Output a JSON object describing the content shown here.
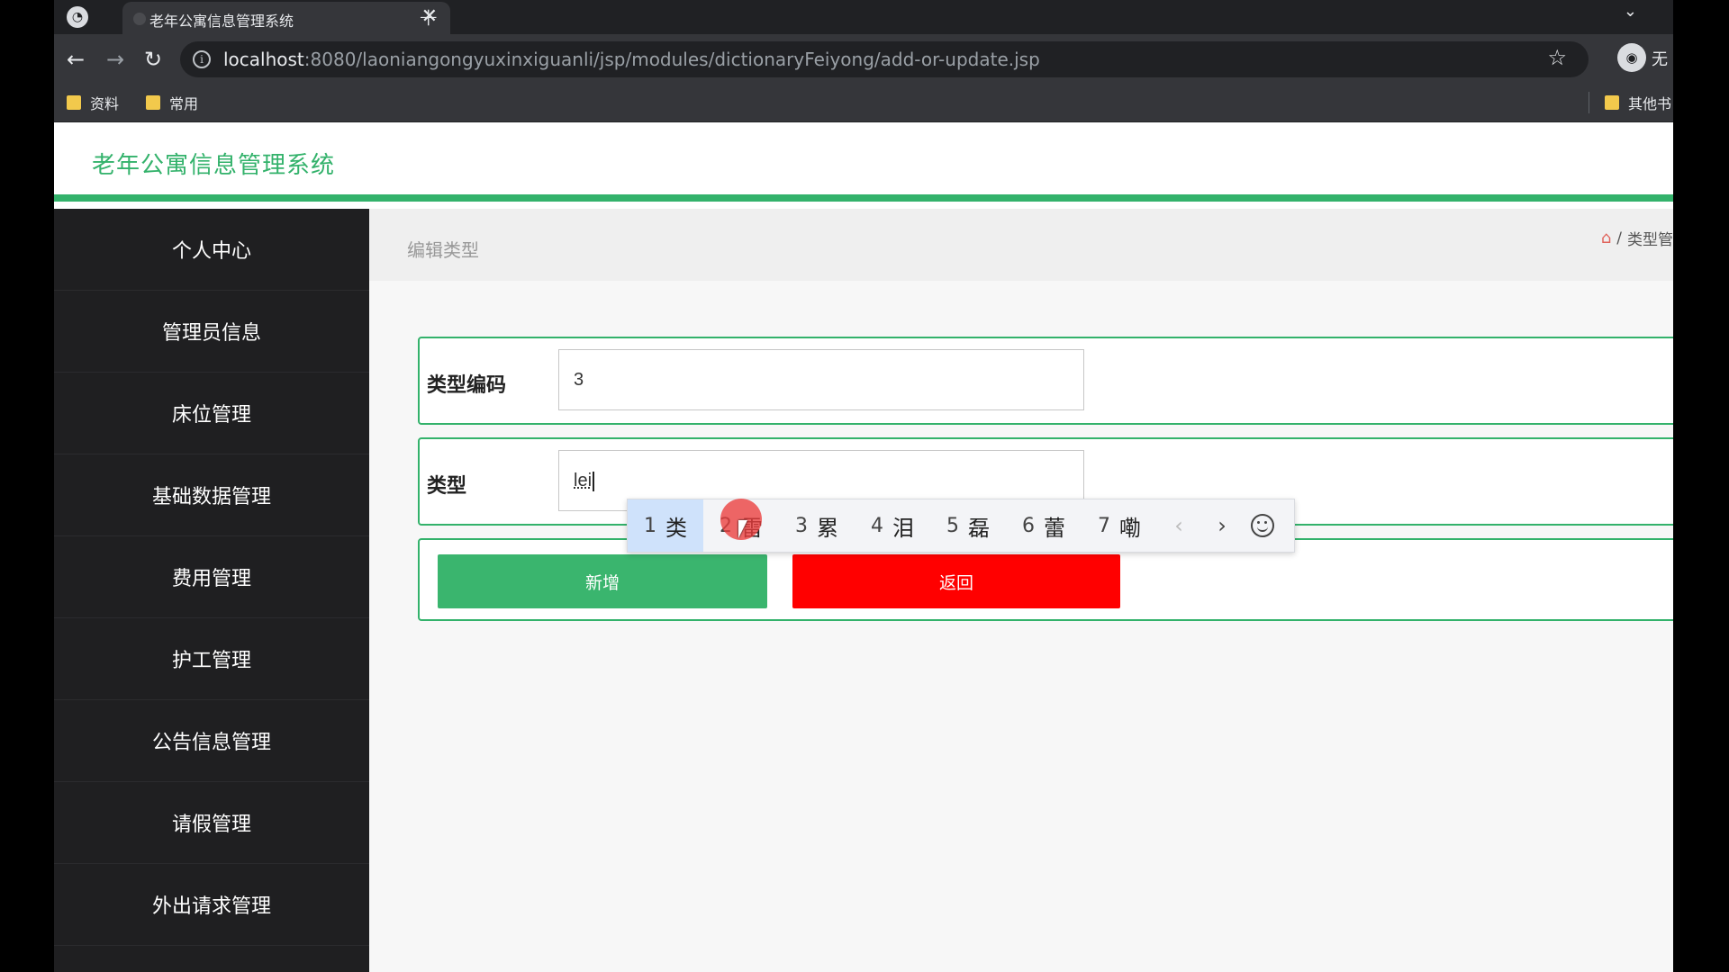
{
  "browser": {
    "tab_title": "老年公寓信息管理系统",
    "tab_close": "✕",
    "new_tab": "+",
    "url_host": "localhost",
    "url_rest": ":8080/laoniangongyuxinxiguanli/jsp/modules/dictionaryFeiyong/add-or-update.jsp",
    "profile_label": "无",
    "bookmarks": [
      "资料",
      "常用"
    ],
    "other_bookmarks": "其他书"
  },
  "site": {
    "title": "老年公寓信息管理系统"
  },
  "sidebar": {
    "items": [
      {
        "label": "个人中心"
      },
      {
        "label": "管理员信息"
      },
      {
        "label": "床位管理"
      },
      {
        "label": "基础数据管理"
      },
      {
        "label": "费用管理"
      },
      {
        "label": "护工管理"
      },
      {
        "label": "公告信息管理"
      },
      {
        "label": "请假管理"
      },
      {
        "label": "外出请求管理"
      }
    ]
  },
  "content": {
    "page_title": "编辑类型",
    "breadcrumb_sep": "/",
    "breadcrumb_current": "类型管",
    "form": {
      "code_label": "类型编码",
      "code_value": "3",
      "type_label": "类型",
      "type_value": "lei"
    },
    "buttons": {
      "add": "新增",
      "back": "返回"
    }
  },
  "ime": {
    "candidates": [
      {
        "num": "1",
        "char": "类"
      },
      {
        "num": "2",
        "char": "雷"
      },
      {
        "num": "3",
        "char": "累"
      },
      {
        "num": "4",
        "char": "泪"
      },
      {
        "num": "5",
        "char": "磊"
      },
      {
        "num": "6",
        "char": "蕾"
      },
      {
        "num": "7",
        "char": "嘞"
      }
    ],
    "selected_index": 0
  },
  "colors": {
    "accent": "#33b26b",
    "danger": "#ff0000",
    "sidebar_bg": "#1f1f21"
  }
}
